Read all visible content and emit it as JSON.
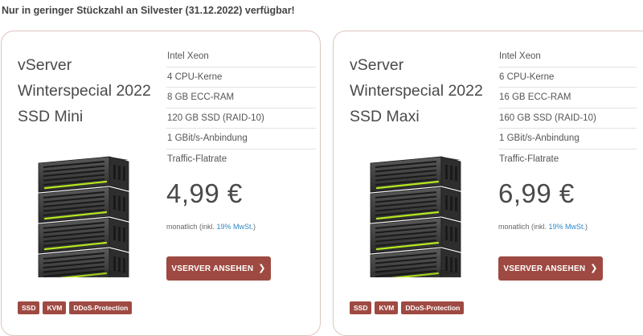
{
  "notice": "Nur in geringer Stückzahl an Silvester (31.12.2022) verfügbar!",
  "colors": {
    "accent": "#9e4a42",
    "link": "#2f86c4",
    "card_border": "#dcc5bf",
    "led": "#b6e81e"
  },
  "cards": [
    {
      "title": "vServer Winterspecial 2022 SSD Mini",
      "specs": [
        "Intel Xeon",
        "4 CPU-Kerne",
        "8 GB ECC-RAM",
        "120 GB SSD (RAID-10)",
        "1 GBit/s-Anbindung",
        "Traffic-Flatrate"
      ],
      "price": "4,99 €",
      "vat_prefix": "monatlich (inkl. ",
      "vat_link": "19% MwSt.",
      "vat_suffix": ")",
      "button_label": "VSERVER ANSEHEN",
      "button_icon": "chevron-right-icon",
      "image": "server-rack-icon",
      "tags": [
        "SSD",
        "KVM",
        "DDoS-Protection"
      ]
    },
    {
      "title": "vServer Winterspecial 2022 SSD Maxi",
      "specs": [
        "Intel Xeon",
        "6 CPU-Kerne",
        "16 GB ECC-RAM",
        "160 GB SSD (RAID-10)",
        "1 GBit/s-Anbindung",
        "Traffic-Flatrate"
      ],
      "price": "6,99 €",
      "vat_prefix": "monatlich (inkl. ",
      "vat_link": "19% MwSt.",
      "vat_suffix": ")",
      "button_label": "VSERVER ANSEHEN",
      "button_icon": "chevron-right-icon",
      "image": "server-rack-icon",
      "tags": [
        "SSD",
        "KVM",
        "DDoS-Protection"
      ]
    }
  ]
}
